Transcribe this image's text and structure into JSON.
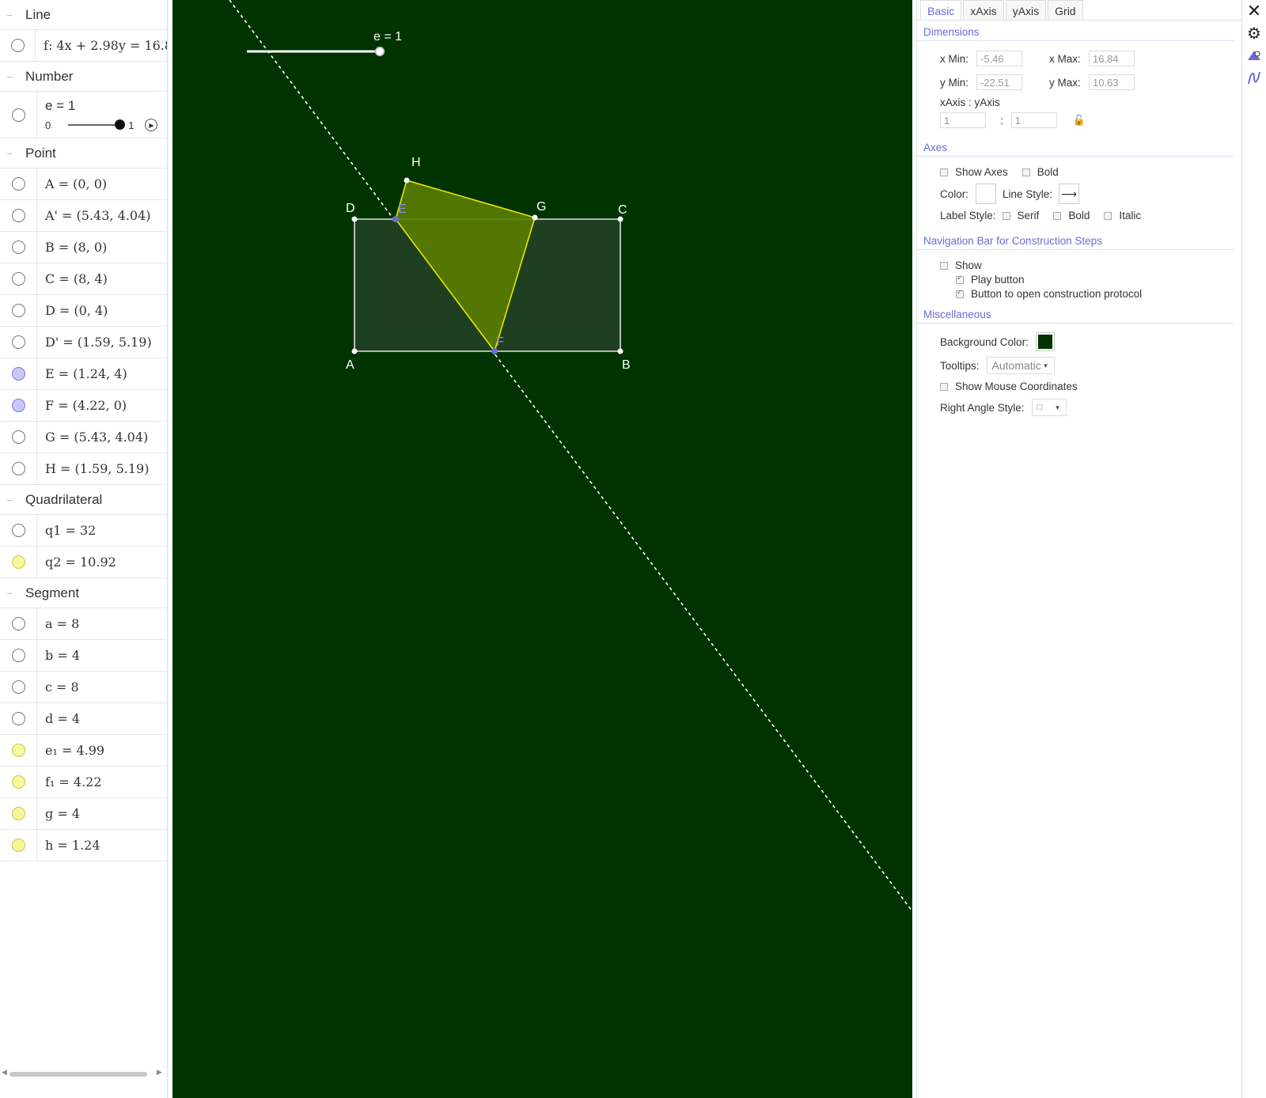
{
  "algebra": {
    "groups": [
      {
        "title": "Line",
        "items": [
          {
            "expr": "f: 4x + 2.98y = 16.8",
            "marble": "empty"
          }
        ]
      },
      {
        "title": "Number",
        "slider": {
          "label": "e = 1",
          "min": "0",
          "max": "1",
          "value": 1
        }
      },
      {
        "title": "Point",
        "items": [
          {
            "expr": "A = (0, 0)",
            "marble": "empty"
          },
          {
            "expr": "A' = (5.43, 4.04)",
            "marble": "empty"
          },
          {
            "expr": "B = (8, 0)",
            "marble": "empty"
          },
          {
            "expr": "C = (8, 4)",
            "marble": "empty"
          },
          {
            "expr": "D = (0, 4)",
            "marble": "empty"
          },
          {
            "expr": "D' = (1.59, 5.19)",
            "marble": "empty"
          },
          {
            "expr": "E = (1.24, 4)",
            "marble": "blue"
          },
          {
            "expr": "F = (4.22, 0)",
            "marble": "blue"
          },
          {
            "expr": "G = (5.43, 4.04)",
            "marble": "empty"
          },
          {
            "expr": "H = (1.59, 5.19)",
            "marble": "empty"
          }
        ]
      },
      {
        "title": "Quadrilateral",
        "items": [
          {
            "expr": "q1 = 32",
            "marble": "empty"
          },
          {
            "expr": "q2 = 10.92",
            "marble": "yellow"
          }
        ]
      },
      {
        "title": "Segment",
        "items": [
          {
            "expr": "a = 8",
            "marble": "empty"
          },
          {
            "expr": "b = 4",
            "marble": "empty"
          },
          {
            "expr": "c = 8",
            "marble": "empty"
          },
          {
            "expr": "d = 4",
            "marble": "empty"
          },
          {
            "expr": "e₁ = 4.99",
            "marble": "yellow"
          },
          {
            "expr": "f₁ = 4.22",
            "marble": "yellow"
          },
          {
            "expr": "g = 4",
            "marble": "yellow"
          },
          {
            "expr": "h = 1.24",
            "marble": "yellow"
          }
        ]
      }
    ]
  },
  "graphics": {
    "background": "#003300",
    "slider_label": "e = 1",
    "slider_value": 1,
    "point_labels": {
      "A": "A",
      "B": "B",
      "C": "C",
      "D": "D",
      "E": "E",
      "F": "F",
      "G": "G",
      "H": "H"
    },
    "rectangle_fill": "#1e4020",
    "folded_fill": "#5a7d00",
    "folded_stroke": "#e6e600",
    "free_point_color": "#6b6bd6"
  },
  "properties": {
    "tabs": [
      "Basic",
      "xAxis",
      "yAxis",
      "Grid"
    ],
    "active_tab": "Basic",
    "dimensions": {
      "title": "Dimensions",
      "xmin_label": "x Min:",
      "xmin": "-5.46",
      "xmax_label": "x Max:",
      "xmax": "16.84",
      "ymin_label": "y Min:",
      "ymin": "-22.51",
      "ymax_label": "y Max:",
      "ymax": "10.63",
      "ratio_label": "xAxis : yAxis",
      "ratio_x": "1",
      "ratio_sep": ":",
      "ratio_y": "1"
    },
    "axes": {
      "title": "Axes",
      "show_axes": "Show Axes",
      "show_axes_checked": false,
      "bold": "Bold",
      "bold_checked": false,
      "color_label": "Color:",
      "line_style_label": "Line Style:",
      "label_style_label": "Label Style:",
      "serif": "Serif",
      "label_bold": "Bold",
      "italic": "Italic"
    },
    "navbar": {
      "title": "Navigation Bar for Construction Steps",
      "show": "Show",
      "show_checked": false,
      "play_button": "Play button",
      "play_checked": true,
      "protocol_button": "Button to open construction protocol",
      "protocol_checked": true
    },
    "misc": {
      "title": "Miscellaneous",
      "bg_color_label": "Background Color:",
      "bg_color": "#003300",
      "tooltips_label": "Tooltips:",
      "tooltips_value": "Automatic",
      "mouse_coords": "Show Mouse Coordinates",
      "mouse_coords_checked": false,
      "right_angle_label": "Right Angle Style:",
      "right_angle_value": "□"
    }
  },
  "side_icons": [
    "close-icon",
    "gear-icon",
    "graphics-style-icon",
    "function-icon"
  ]
}
